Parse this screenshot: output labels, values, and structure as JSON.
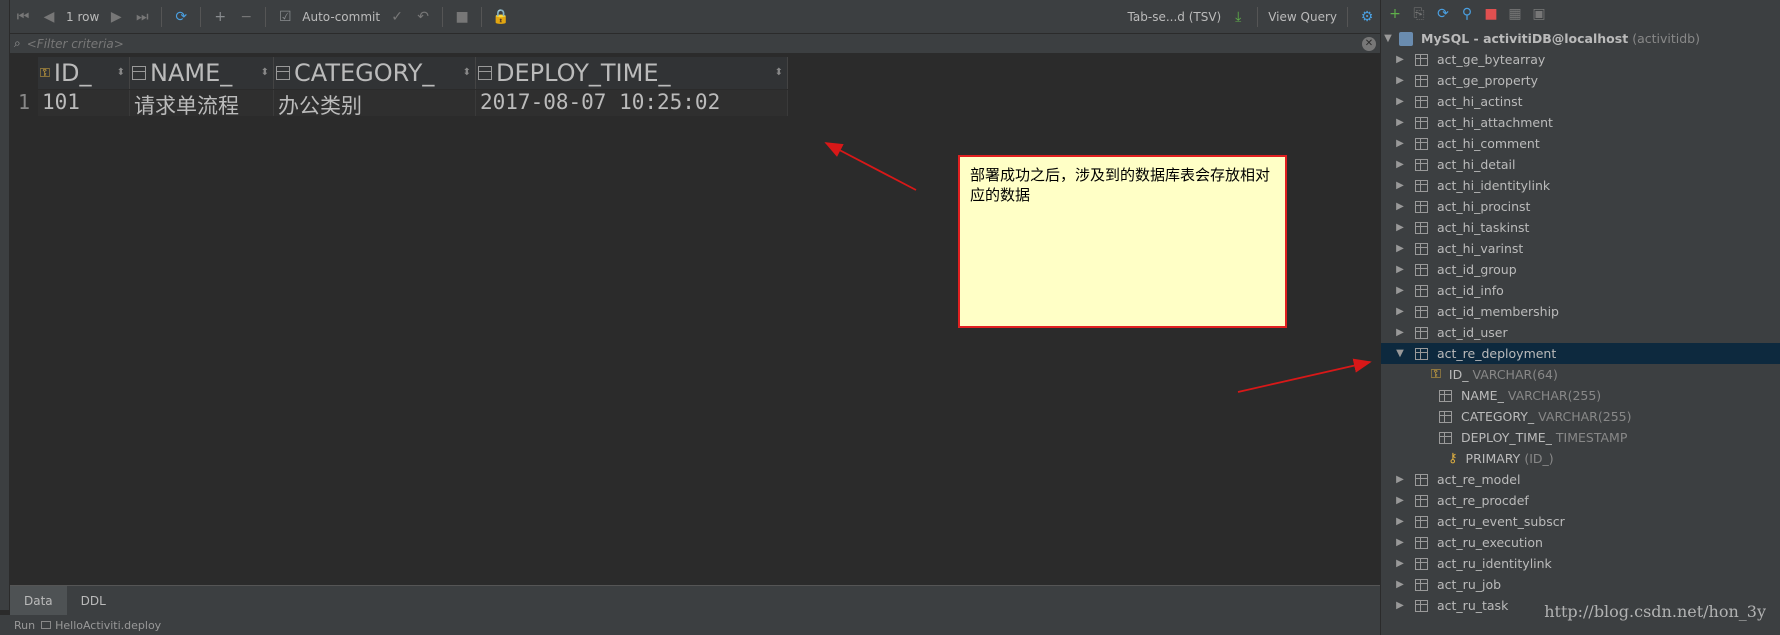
{
  "toolbar": {
    "row_count": "1 row",
    "autocommit": "Auto-commit",
    "export_format": "Tab-se...d (TSV)",
    "view_query": "View Query"
  },
  "filter": {
    "placeholder": "<Filter criteria>"
  },
  "grid": {
    "columns": [
      "ID_",
      "NAME_",
      "CATEGORY_",
      "DEPLOY_TIME_"
    ],
    "rows": [
      {
        "num": "1",
        "cells": [
          "101",
          "请求单流程",
          "办公类别",
          "2017-08-07 10:25:02"
        ]
      }
    ]
  },
  "annotation": {
    "text": "部署成功之后，涉及到的数据库表会存放相对应的数据"
  },
  "bottom_tabs": [
    "Data",
    "DDL"
  ],
  "status": {
    "prefix": "Run",
    "run_target": "HelloActiviti.deploy"
  },
  "tree": {
    "root_label": "MySQL - activitiDB@localhost",
    "root_schema": "(activitidb)",
    "tables_before": [
      "act_ge_bytearray",
      "act_ge_property",
      "act_hi_actinst",
      "act_hi_attachment",
      "act_hi_comment",
      "act_hi_detail",
      "act_hi_identitylink",
      "act_hi_procinst",
      "act_hi_taskinst",
      "act_hi_varinst",
      "act_id_group",
      "act_id_info",
      "act_id_membership",
      "act_id_user"
    ],
    "selected_table": "act_re_deployment",
    "selected_columns": [
      {
        "name": "ID_",
        "type": "VARCHAR(64)"
      },
      {
        "name": "NAME_",
        "type": "VARCHAR(255)"
      },
      {
        "name": "CATEGORY_",
        "type": "VARCHAR(255)"
      },
      {
        "name": "DEPLOY_TIME_",
        "type": "TIMESTAMP"
      }
    ],
    "primary_key": {
      "name": "PRIMARY",
      "cols": "(ID_)"
    },
    "tables_after": [
      "act_re_model",
      "act_re_procdef",
      "act_ru_event_subscr",
      "act_ru_execution",
      "act_ru_identitylink",
      "act_ru_job",
      "act_ru_task"
    ]
  },
  "watermark": "http://blog.csdn.net/hon_3y",
  "colors": {
    "accent": "#4a9fe0",
    "selection": "#0d293e",
    "note_bg": "#ffffc6",
    "note_border": "#e02020",
    "arrow": "#d81818"
  }
}
